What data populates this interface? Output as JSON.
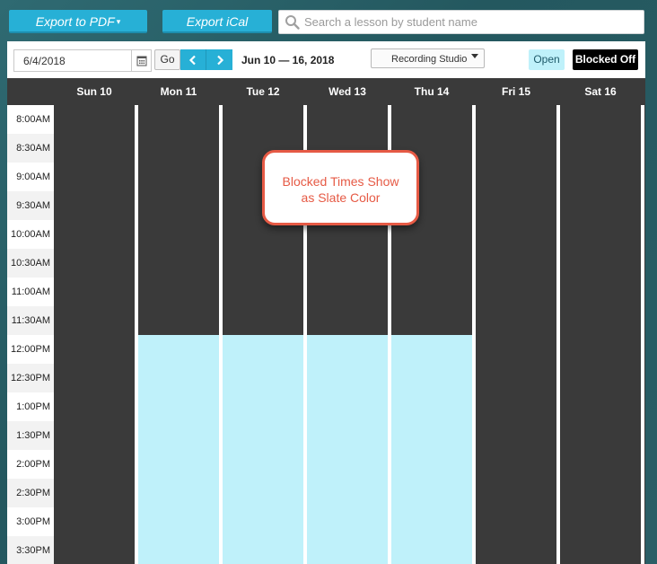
{
  "toolbar_top": {
    "export_pdf_label": "Export to PDF",
    "export_ical_label": "Export iCal",
    "search_placeholder": "Search a lesson by student name"
  },
  "controls": {
    "date_value": "6/4/2018",
    "go_label": "Go",
    "range_label": "Jun 10 — 16, 2018",
    "studio_selected": "Recording Studio",
    "legend_open": "Open",
    "legend_blocked": "Blocked Off"
  },
  "days": [
    "Sun 10",
    "Mon 11",
    "Tue 12",
    "Wed 13",
    "Thu 14",
    "Fri 15",
    "Sat 16"
  ],
  "times": [
    "8:00AM",
    "8:30AM",
    "9:00AM",
    "9:30AM",
    "10:00AM",
    "10:30AM",
    "11:00AM",
    "11:30AM",
    "12:00PM",
    "12:30PM",
    "1:00PM",
    "1:30PM",
    "2:00PM",
    "2:30PM",
    "3:00PM",
    "3:30PM"
  ],
  "callout": {
    "line1": "Blocked Times Show",
    "line2": "as Slate Color"
  },
  "colors": {
    "accent": "#27b0d6",
    "blocked": "#3a3a3a",
    "open": "#bff1fa",
    "callout": "#e65a45"
  },
  "open_slots": {
    "days": [
      "Mon 11",
      "Tue 12",
      "Wed 13",
      "Thu 14"
    ],
    "start": "12:00PM",
    "end": "3:30PM"
  }
}
